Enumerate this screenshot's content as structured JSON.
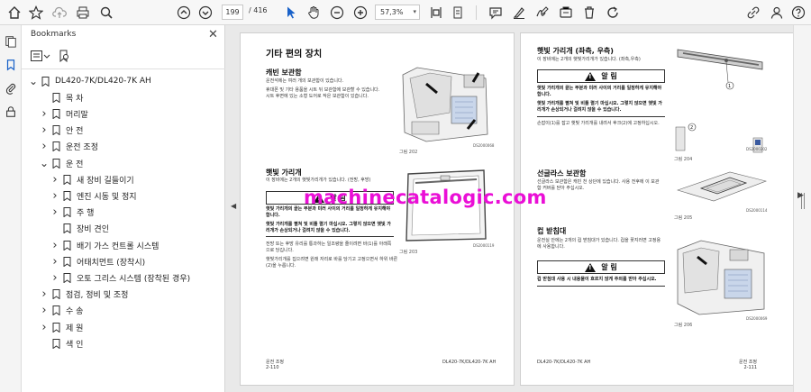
{
  "toolbar": {
    "current_page": "199",
    "total_pages": "/ 416",
    "zoom": "57,3%",
    "icons": [
      "home-icon",
      "bookmark-star-icon",
      "cloud-upload-icon",
      "print-icon",
      "zoom-search-icon",
      "page-up-icon",
      "page-down-icon",
      "select-cursor-icon",
      "hand-icon",
      "zoom-out-icon",
      "zoom-in-icon",
      "fit-page-icon",
      "scroll-mode-icon",
      "comment-icon",
      "highlight-icon",
      "sign-icon",
      "stamp-icon",
      "delete-icon",
      "rotate-icon",
      "share-icon",
      "user-icon"
    ]
  },
  "bookmarks_panel": {
    "title": "Bookmarks",
    "items": [
      {
        "label": "DL420-7K/DL420-7K AH",
        "level": 0,
        "expander": "v"
      },
      {
        "label": "목 차",
        "level": 1,
        "expander": ""
      },
      {
        "label": "머리말",
        "level": 1,
        "expander": ">"
      },
      {
        "label": "안 전",
        "level": 1,
        "expander": ">"
      },
      {
        "label": "운전 조정",
        "level": 1,
        "expander": ">"
      },
      {
        "label": "운 전",
        "level": 1,
        "expander": "v"
      },
      {
        "label": "새 장비 길들이기",
        "level": 2,
        "expander": ">"
      },
      {
        "label": "엔진 시동 및 정지",
        "level": 2,
        "expander": ">"
      },
      {
        "label": "주 행",
        "level": 2,
        "expander": ">"
      },
      {
        "label": "장비 견인",
        "level": 2,
        "expander": ""
      },
      {
        "label": "배기 가스 컨트롤 시스템",
        "level": 2,
        "expander": ">"
      },
      {
        "label": "어태치먼트 (장착시)",
        "level": 2,
        "expander": ">"
      },
      {
        "label": "오토 그리스 시스템 (장착된 경우)",
        "level": 2,
        "expander": ">"
      },
      {
        "label": "점검, 정비 및 조정",
        "level": 1,
        "expander": ">"
      },
      {
        "label": "수 송",
        "level": 1,
        "expander": ">"
      },
      {
        "label": "제 원",
        "level": 1,
        "expander": ">"
      },
      {
        "label": "색 인",
        "level": 1,
        "expander": ""
      }
    ]
  },
  "left_page": {
    "title": "기타 편의 장치",
    "sec1_title": "캐빈 보관함",
    "sec1_lines": [
      "운전석에는 여러 개의 보관함이 있습니다.",
      "휴대폰 및 기타 용품을 시트 뒤 보관함에 보관할 수 있습니다.",
      "시트 후면에 있는 소형 도어로 작은 보관함이 있습니다."
    ],
    "fig1": "그림 202",
    "fig1_code": "DS2000068",
    "sec2_title": "햇빛 가리개",
    "sec2_lines": [
      "이 장비에는 2개의 햇빛가리개가 있습니다. (전방, 후방)"
    ],
    "warn_label": "알 림",
    "warn_lines": [
      "햇빛 가리개의 끝는 부분과 미러 사이의 거리를 일정하게 유지해야",
      "합니다."
    ],
    "caution_lines": [
      "햇빛 가리개를 펼쳐 및 비틀 렬기 마십시오. 그렇지 않으면 햇빛 가",
      "리개가 손상되거나 걸려지 않을 수 있습니다."
    ],
    "sec2_note_lines": [
      "전방 또는 후방 유리를 통과하는 일조량을 줄이려면 바(1)를 아래쪽",
      "으로 당깁니다.",
      "햇빛가리개를 집으려면 원래 자리로 바를 당기고 고정으면서 하위 바른",
      "(2)을 누릅니다."
    ],
    "fig2": "그림 203",
    "fig2_code": "DS2000119",
    "footer_left": "운전 조정\n2-110",
    "footer_right": "DL420-7K/DL420-7K AH"
  },
  "right_page": {
    "sec1_title": "햇빛 가리개 (좌측, 우측)",
    "sec1_lines": [
      "이 장비에는 2개의 햇빛가리개가 있습니다. (좌측,우측)"
    ],
    "warn_label": "알 림",
    "warn_lines": [
      "햇빛 가리개의 끝는 부분과 미러 사이의 거리를 일정하게 유지해야",
      "합니다.",
      "햇빛 가리개를 펼쳐 및 비틀 렬기 마십시오. 그렇지 않으면 햇빛 가",
      "리개가 손상되거나 걸려지 않을 수 있습니다."
    ],
    "note_lines": [
      "손잡이(1)를 잡고 햇빛 가리개를 내려서 후크(2)에 고정하십시오."
    ],
    "fig1": "그림 204",
    "fig1_code": "DS2000202",
    "label_1": "1",
    "label_2": "2",
    "sec2_title": "선글라스 보관함",
    "sec2_lines": [
      "선글라스 보관함은 캐빈 천 상단에 있습니다. 사용 전후에 이 보관",
      "함 커버를 닫아 주십시오."
    ],
    "fig2": "그림 205",
    "fig2_code": "DS2000114",
    "sec3_title": "컵 받침대",
    "sec3_lines": [
      "운전실 안에는 2개의 컵 받침대가 있습니다. 컵을 꽂지러면 고정용",
      "에 사용합니다."
    ],
    "warn2_label": "알 림",
    "warn2_lines": [
      "컵 받침대 사용 시 내용물이 흐르지 않게 주의를 받아 주십시오."
    ],
    "fig3": "그림 206",
    "fig3_code": "DS2000069",
    "footer_left": "DL420-7K/DL420-7K AH",
    "footer_right": "운전 조정\n2-111"
  },
  "watermark": "machinecatalogic.com"
}
